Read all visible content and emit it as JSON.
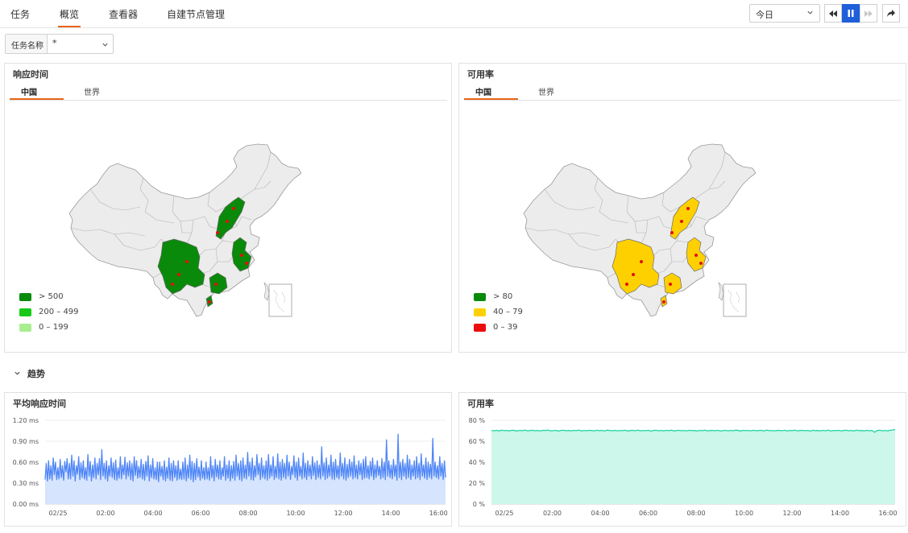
{
  "nav": {
    "tabs": [
      "任务",
      "概览",
      "查看器",
      "自建节点管理"
    ],
    "active": 1,
    "time_range": "今日"
  },
  "filter": {
    "label": "任务名称",
    "value": "*"
  },
  "map_panels": [
    {
      "title": "响应时间",
      "tabs": [
        "中国",
        "世界"
      ],
      "active_tab": 0,
      "highlight_color": "#0a8a0a",
      "legend": [
        {
          "label": "> 500",
          "color": "#0a8a0a"
        },
        {
          "label": "200 – 499",
          "color": "#17c917"
        },
        {
          "label": "0 – 199",
          "color": "#a8ee8e"
        }
      ]
    },
    {
      "title": "可用率",
      "tabs": [
        "中国",
        "世界"
      ],
      "active_tab": 0,
      "highlight_color": "#ffd000",
      "legend": [
        {
          "label": "> 80",
          "color": "#0a8a0a"
        },
        {
          "label": "40 – 79",
          "color": "#ffd000"
        },
        {
          "label": "0 – 39",
          "color": "#ee0b0b"
        }
      ]
    }
  ],
  "trend": {
    "label": "趋势"
  },
  "chart_data": [
    {
      "type": "area",
      "title": "平均响应时间",
      "color": "#4f86f7",
      "fill": "#d6e4fd",
      "yticks": [
        "0.00 ms",
        "0.30 ms",
        "0.60 ms",
        "0.90 ms",
        "1.20 ms"
      ],
      "ylim": [
        0,
        1.2
      ],
      "xticks": [
        "02/25",
        "02:00",
        "04:00",
        "06:00",
        "08:00",
        "10:00",
        "12:00",
        "14:00",
        "16:00"
      ],
      "series": [
        {
          "values": [
            0.35,
            0.58,
            0.33,
            0.62,
            0.36,
            0.55,
            0.34,
            0.66,
            0.42,
            0.6,
            0.35,
            0.52,
            0.36,
            0.64,
            0.38,
            0.55,
            0.34,
            0.61,
            0.46,
            0.65,
            0.36,
            0.58,
            0.36,
            0.7,
            0.4,
            0.62,
            0.33,
            0.55,
            0.43,
            0.68,
            0.35,
            0.59,
            0.38,
            0.62,
            0.36,
            0.52,
            0.34,
            0.71,
            0.4,
            0.61,
            0.33,
            0.56,
            0.38,
            0.66,
            0.36,
            0.58,
            0.42,
            0.65,
            0.35,
            0.78,
            0.4,
            0.58,
            0.36,
            0.62,
            0.33,
            0.55,
            0.4,
            0.66,
            0.38,
            0.59,
            0.35,
            0.63,
            0.34,
            0.52,
            0.37,
            0.68,
            0.36,
            0.56,
            0.42,
            0.67,
            0.36,
            0.59,
            0.4,
            0.62,
            0.35,
            0.58,
            0.33,
            0.68,
            0.41,
            0.62,
            0.37,
            0.54,
            0.38,
            0.64,
            0.36,
            0.57,
            0.34,
            0.61,
            0.4,
            0.69,
            0.33,
            0.56,
            0.38,
            0.65,
            0.36,
            0.52,
            0.35,
            0.6,
            0.32,
            0.6,
            0.4,
            0.54,
            0.35,
            0.62,
            0.33,
            0.53,
            0.37,
            0.66,
            0.34,
            0.58,
            0.33,
            0.62,
            0.38,
            0.55,
            0.34,
            0.62,
            0.36,
            0.5,
            0.35,
            0.6,
            0.36,
            0.66,
            0.33,
            0.56,
            0.37,
            0.7,
            0.35,
            0.61,
            0.32,
            0.58,
            0.35,
            0.65,
            0.39,
            0.53,
            0.34,
            0.62,
            0.37,
            0.52,
            0.35,
            0.6,
            0.36,
            0.52,
            0.34,
            0.68,
            0.38,
            0.55,
            0.33,
            0.64,
            0.39,
            0.56,
            0.36,
            0.62,
            0.35,
            0.52,
            0.4,
            0.68,
            0.34,
            0.56,
            0.37,
            0.62,
            0.33,
            0.55,
            0.37,
            0.61,
            0.34,
            0.7,
            0.4,
            0.58,
            0.35,
            0.62,
            0.33,
            0.66,
            0.37,
            0.56,
            0.36,
            0.74,
            0.4,
            0.6,
            0.35,
            0.66,
            0.34,
            0.55,
            0.39,
            0.71,
            0.42,
            0.58,
            0.35,
            0.66,
            0.38,
            0.55,
            0.36,
            0.62,
            0.34,
            0.71,
            0.37,
            0.56,
            0.4,
            0.68,
            0.35,
            0.54,
            0.38,
            0.72,
            0.36,
            0.6,
            0.34,
            0.64,
            0.38,
            0.58,
            0.36,
            0.7,
            0.4,
            0.6,
            0.35,
            0.54,
            0.42,
            0.69,
            0.38,
            0.6,
            0.34,
            0.66,
            0.4,
            0.54,
            0.36,
            0.73,
            0.38,
            0.58,
            0.35,
            0.62,
            0.4,
            0.56,
            0.36,
            0.68,
            0.41,
            0.59,
            0.35,
            0.62,
            0.38,
            0.56,
            0.36,
            0.82,
            0.4,
            0.59,
            0.35,
            0.66,
            0.37,
            0.56,
            0.4,
            0.7,
            0.36,
            0.6,
            0.35,
            0.64,
            0.38,
            0.55,
            0.36,
            0.73,
            0.4,
            0.58,
            0.36,
            0.66,
            0.34,
            0.57,
            0.38,
            0.64,
            0.4,
            0.6,
            0.36,
            0.69,
            0.38,
            0.56,
            0.36,
            0.62,
            0.42,
            0.58,
            0.35,
            0.64,
            0.37,
            0.68,
            0.38,
            0.55,
            0.36,
            0.61,
            0.4,
            0.66,
            0.35,
            0.56,
            0.38,
            0.62,
            0.41,
            0.54,
            0.36,
            0.65,
            0.38,
            0.6,
            0.35,
            0.92,
            0.4,
            0.62,
            0.38,
            0.56,
            0.36,
            0.64,
            0.4,
            0.56,
            0.34,
            1.0,
            0.38,
            0.6,
            0.35,
            0.64,
            0.4,
            0.58,
            0.36,
            0.7,
            0.38,
            0.64,
            0.35,
            0.56,
            0.4,
            0.62,
            0.36,
            0.68,
            0.38,
            0.58,
            0.35,
            0.72,
            0.4,
            0.56,
            0.37,
            0.66,
            0.35,
            0.6,
            0.38,
            0.57,
            0.36,
            0.94,
            0.4,
            0.6,
            0.38,
            0.55,
            0.36,
            0.68,
            0.4,
            0.58,
            0.35,
            0.62,
            0.38
          ]
        }
      ]
    },
    {
      "type": "area",
      "title": "可用率",
      "color": "#20d4a0",
      "fill": "#ccf7ea",
      "yticks": [
        "0 %",
        "20 %",
        "40 %",
        "60 %",
        "80 %"
      ],
      "ylim": [
        0,
        80
      ],
      "xticks": [
        "02/25",
        "02:00",
        "04:00",
        "06:00",
        "08:00",
        "10:00",
        "12:00",
        "14:00",
        "16:00"
      ],
      "series": [
        {
          "values": [
            70.3,
            70.0,
            70.4,
            69.8,
            70.6,
            70.1,
            70.3,
            69.9,
            70.5,
            70.2,
            69.8,
            70.4,
            70.1,
            70.6,
            69.9,
            70.2,
            70.5,
            70.0,
            70.3,
            69.8,
            70.4,
            70.2,
            70.6,
            69.9,
            70.1,
            70.4,
            69.7,
            70.3,
            70.5,
            70.0,
            70.2,
            69.9,
            70.4,
            70.1,
            70.6,
            69.8,
            70.3,
            70.0,
            70.4,
            70.2,
            69.9,
            70.5,
            70.1,
            70.3,
            69.8,
            70.6,
            70.2,
            70.0,
            70.4,
            69.9,
            70.3,
            70.1,
            70.5,
            69.8,
            70.2,
            70.4,
            70.0,
            70.6,
            69.9,
            70.3,
            70.1,
            70.4,
            69.7,
            70.2,
            70.5,
            70.0,
            70.3,
            69.9,
            70.4,
            70.1,
            70.6,
            69.8,
            70.2,
            70.4,
            70.0,
            70.3,
            69.9,
            70.5,
            70.1,
            70.2,
            69.8,
            70.4,
            70.0,
            70.6,
            69.9,
            70.2,
            70.3,
            70.0,
            70.5,
            69.8,
            70.1,
            70.4,
            69.9,
            70.3,
            70.0,
            70.6,
            70.2,
            69.8,
            70.4,
            70.1,
            70.3,
            69.9,
            70.5,
            70.0,
            70.2,
            70.4,
            69.8,
            70.6,
            70.1,
            70.3,
            69.9,
            70.2,
            70.4,
            70.0,
            70.5,
            69.8,
            70.3,
            70.1,
            70.6,
            69.9,
            70.2,
            70.4,
            70.0,
            70.3,
            69.7,
            70.5,
            70.1,
            70.2,
            69.9,
            70.4,
            70.0,
            70.6,
            69.8,
            70.3,
            70.1,
            70.4,
            69.9,
            70.2,
            70.5,
            70.0,
            70.3,
            69.8,
            70.6,
            70.1,
            70.2,
            69.9,
            70.4,
            70.0,
            70.3,
            68.6,
            70.2,
            70.5,
            70.0,
            70.3,
            69.9,
            70.4,
            70.8,
            71.2
          ]
        }
      ]
    }
  ]
}
